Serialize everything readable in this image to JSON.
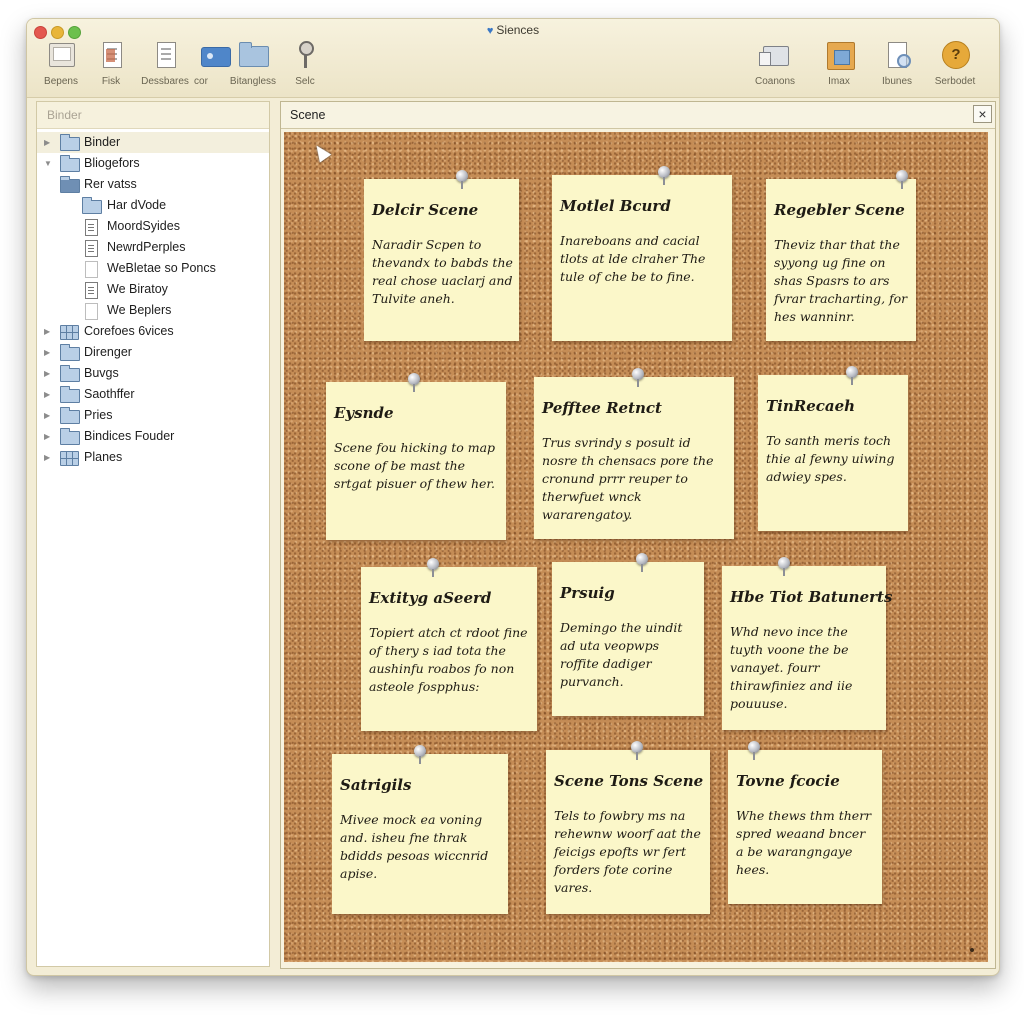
{
  "window": {
    "title": "Siences"
  },
  "toolbar": {
    "left": [
      {
        "label": "Bepens",
        "icon": "window-icon"
      },
      {
        "label": "Fisk",
        "icon": "document-icon"
      },
      {
        "label": "Dessbares",
        "icon": "document-icon"
      },
      {
        "label": "cor",
        "icon": "photo-icon"
      },
      {
        "label": "Bitangless",
        "icon": "folder-icon"
      },
      {
        "label": "Selc",
        "icon": "key-icon"
      }
    ],
    "right": [
      {
        "label": "Coanons",
        "icon": "stack-icon"
      },
      {
        "label": "Imax",
        "icon": "image-icon"
      },
      {
        "label": "Ibunes",
        "icon": "inspector-icon"
      },
      {
        "label": "Serbodet",
        "icon": "help-icon"
      }
    ]
  },
  "binder": {
    "header": "Binder",
    "items": [
      {
        "label": "Binder",
        "icon": "folder-icon",
        "disclosure": "▶",
        "level": 0,
        "selected": true
      },
      {
        "label": "Bliogefors",
        "icon": "folder-icon",
        "disclosure": "▼",
        "level": 0
      },
      {
        "label": "Rer vatss",
        "icon": "folder-icon",
        "disclosure": "",
        "level": 1
      },
      {
        "label": "Har dVode",
        "icon": "folder-icon",
        "disclosure": "",
        "level": 2
      },
      {
        "label": "MoordSyides",
        "icon": "document-icon",
        "disclosure": "",
        "level": 2
      },
      {
        "label": "NewrdPerples",
        "icon": "document-icon",
        "disclosure": "",
        "level": 2
      },
      {
        "label": "WeBletae so Poncs",
        "icon": "blank-document-icon",
        "disclosure": "",
        "level": 2
      },
      {
        "label": "We Biratoy",
        "icon": "document-icon",
        "disclosure": "",
        "level": 2
      },
      {
        "label": "We Beplers",
        "icon": "blank-document-icon",
        "disclosure": "",
        "level": 2
      },
      {
        "label": "Corefoes 6vices",
        "icon": "grid-icon",
        "disclosure": "▶",
        "level": 0
      },
      {
        "label": "Direnger",
        "icon": "folder-icon",
        "disclosure": "▶",
        "level": 0
      },
      {
        "label": "Buvgs",
        "icon": "folder-icon",
        "disclosure": "▶",
        "level": 0
      },
      {
        "label": "Saothffer",
        "icon": "folder-icon",
        "disclosure": "▶",
        "level": 0
      },
      {
        "label": "Pries",
        "icon": "folder-icon",
        "disclosure": "▶",
        "level": 0
      },
      {
        "label": "Bindices Fouder",
        "icon": "folder-icon",
        "disclosure": "▶",
        "level": 0
      },
      {
        "label": "Planes",
        "icon": "grid-icon",
        "disclosure": "▶",
        "level": 0
      }
    ]
  },
  "corkboard": {
    "header": "Scene",
    "close_label": "×",
    "cards": [
      {
        "title": "Delcir Scene",
        "body": "Naradir Scpen to thevandx to babds the real chose uaclarj and Tulvite aneh."
      },
      {
        "title": "Motlel Bcurd",
        "body": "Inareboans and cacial tlots at lde clraher The tule of che be to fine."
      },
      {
        "title": "Regebler Scene",
        "body": "Theviz thar that the syyong ug fine on shas Spasrs to ars fvrar tracharting, for hes wanninr."
      },
      {
        "title": "Eysnde",
        "body": "Scene fou hicking to map scone of be mast the srtgat pisuer of thew her."
      },
      {
        "title": "Pefftee Retnct",
        "body": "Trus svrindy s posult id nosre th chensacs pore the cronund prrr reuper to therwfuet wnck wararengatoy."
      },
      {
        "title": "TinRecaeh",
        "body": "To santh meris toch thie al fewny uiwing adwiey spes."
      },
      {
        "title": "Extityg aSeerd",
        "body": "Topiert atch ct rdoot fine of thery s iad tota the aushinfu roabos fo non asteole fospphus:"
      },
      {
        "title": "Prsuig",
        "body": "Demingo the uindit ad uta veopwps roffite dadiger purvanch."
      },
      {
        "title": "Hbe Tiot Batunerts",
        "body": "Whd nevo ince the tuyth voone the be vanayet. fourr thirawfiniez and iie pouuuse."
      },
      {
        "title": "Satrigils",
        "body": "Mivee mock ea voning and. isheu fne thrak bdidds pesoas wiccnrid apise."
      },
      {
        "title": "Scene Tons Scene",
        "body": "Tels to fowbry ms na rehewnw woorf aat the feicigs epofts wr fert forders fote corine vares."
      },
      {
        "title": "Tovne fcocie",
        "body": "Whe thews thm therr spred weaand bncer a be warangngaye hees."
      }
    ]
  }
}
